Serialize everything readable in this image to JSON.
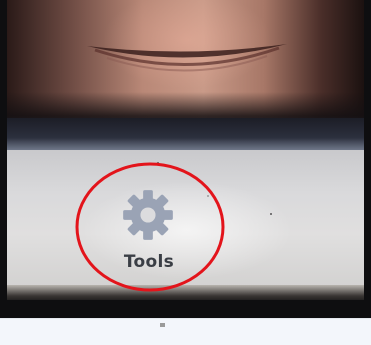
{
  "screen": {
    "tools_button": {
      "label": "Tools",
      "icon": "gear-icon"
    }
  },
  "annotation": {
    "shape": "ellipse",
    "color": "#e3141b"
  },
  "colors": {
    "gear": "#9aa3b5",
    "label": "#3a3e45",
    "screen": "#d9d9db",
    "frame": "#0e0e10"
  }
}
